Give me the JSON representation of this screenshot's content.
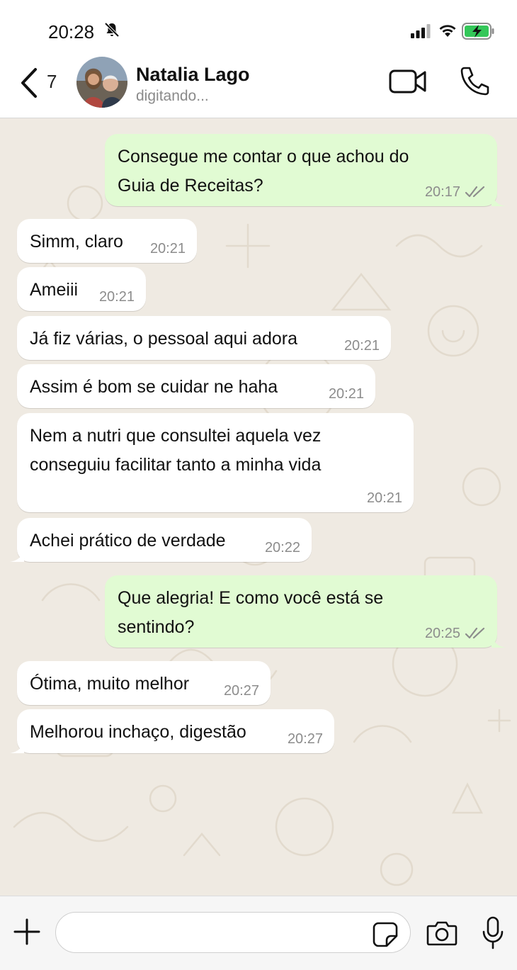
{
  "status_bar": {
    "time": "20:28"
  },
  "header": {
    "back_count": "7",
    "contact_name": "Natalia Lago",
    "contact_status": "digitando..."
  },
  "messages": [
    {
      "dir": "out",
      "text": [
        "Consegue me contar o que achou do",
        "Guia de Receitas?"
      ],
      "time": "20:17",
      "read": true
    },
    {
      "dir": "in",
      "text": [
        "Simm, claro"
      ],
      "time": "20:21"
    },
    {
      "dir": "in",
      "text": [
        "Ameiii"
      ],
      "time": "20:21"
    },
    {
      "dir": "in",
      "text": [
        "Já fiz várias, o pessoal aqui adora"
      ],
      "time": "20:21"
    },
    {
      "dir": "in",
      "text": [
        "Assim  é bom se cuidar ne haha"
      ],
      "time": "20:21"
    },
    {
      "dir": "in",
      "text": [
        "Nem a nutri que consultei aquela vez",
        "conseguiu facilitar tanto a minha vida"
      ],
      "time": "20:21"
    },
    {
      "dir": "in",
      "text": [
        "Achei prático de verdade"
      ],
      "time": "20:22"
    },
    {
      "dir": "out",
      "text": [
        "Que alegria! E como você está se",
        "sentindo?"
      ],
      "time": "20:25",
      "read": true
    },
    {
      "dir": "in",
      "text": [
        "Ótima, muito melhor"
      ],
      "time": "20:27"
    },
    {
      "dir": "in",
      "text": [
        "Melhorou inchaço, digestão"
      ],
      "time": "20:27"
    }
  ],
  "composer": {
    "value": "",
    "placeholder": ""
  },
  "colors": {
    "outgoing": "#e1fbd3",
    "incoming": "#ffffff",
    "wallpaper": "#efeae2",
    "battery": "#34c759"
  }
}
